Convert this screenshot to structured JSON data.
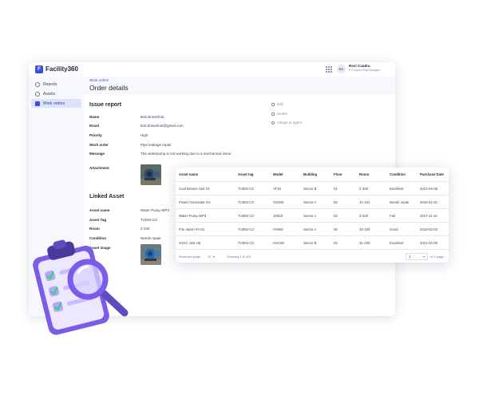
{
  "app": {
    "name": "Facility360",
    "logo_letter": "F",
    "user": {
      "initials": "RC",
      "name": "Rosi Cuadra",
      "role": "FC Centro Park Anlagen"
    }
  },
  "icons": {
    "logo": "building-logo-icon",
    "apps": "grid-icon",
    "reports": "clock-icon",
    "assets": "circle-icon",
    "work_orders": "stack-icon",
    "edit": "pencil-icon",
    "delete": "trash-icon",
    "assign": "person-icon",
    "illustration": "clipboard-checklist-magnifier-icon"
  },
  "colors": {
    "accent": "#3c4fe0",
    "sidebar_active": "#dde3f8",
    "illustration": "#8b6cf0"
  },
  "sidebar": {
    "items": [
      {
        "label": "Reports",
        "active": false
      },
      {
        "label": "Assets",
        "active": false
      },
      {
        "label": "Work orders",
        "active": true
      }
    ]
  },
  "header": {
    "breadcrumb": "Work orders",
    "title": "Order details"
  },
  "issue_report": {
    "title": "Issue report",
    "fields": [
      {
        "label": "Name",
        "value": "Bob Brownfoot"
      },
      {
        "label": "Email",
        "value": "bob.brownfoot@gmail.com"
      },
      {
        "label": "Priority",
        "value": "High"
      },
      {
        "label": "Work order",
        "value": "Pipe leakage repair"
      },
      {
        "label": "Message",
        "value": "The waterpump is not working due to a mechanical issue"
      }
    ],
    "attachment_label": "Attachment"
  },
  "actions": [
    {
      "label": "Edit"
    },
    {
      "label": "Delete"
    },
    {
      "label": "Assign to agent"
    }
  ],
  "linked_asset": {
    "title": "Linked Asset",
    "fields": [
      {
        "label": "Asset name",
        "value": "Water Pump WP3"
      },
      {
        "label": "Asset Tag",
        "value": "TU002-C3"
      },
      {
        "label": "Room",
        "value": "2-230"
      },
      {
        "label": "Condition",
        "value": "Needs repair"
      }
    ],
    "image_label": "Asset image"
  },
  "asset_table": {
    "columns": [
      "Asset name",
      "Asset tag",
      "Model",
      "Building",
      "Floor",
      "Room",
      "Condition",
      "Purchase Date"
    ],
    "rows": [
      [
        "Cool Breeze Unit X1",
        "TU002-C3",
        "AT26",
        "Sector B",
        "01",
        "2-330",
        "Excellent",
        "2021-04-05"
      ],
      [
        "Power Generator G4",
        "TU002-C3",
        "GX200",
        "Sector A",
        "02",
        "41-231",
        "Needs repair",
        "2018-01-01"
      ],
      [
        "Water Pump WP3",
        "TU002-C3",
        "JX910",
        "Sector A",
        "02",
        "2-230",
        "Fair",
        "2017-11-10"
      ],
      [
        "Fire Alarm FA-01",
        "TU002-C3",
        "FA900",
        "Sector A",
        "05",
        "32-100",
        "Good",
        "2019-02-02"
      ],
      [
        "HVAC Unit H5",
        "TU002-C3",
        "HVC50",
        "Sector B",
        "02",
        "31-430",
        "Excellent",
        "2021-04-05"
      ]
    ],
    "footer": {
      "rows_per_page_label": "Rows per page",
      "rows_per_page_value": "10",
      "range_text": "Showing 1-5 of 5",
      "page_value": "1",
      "page_total_text": "of 1 page"
    }
  }
}
